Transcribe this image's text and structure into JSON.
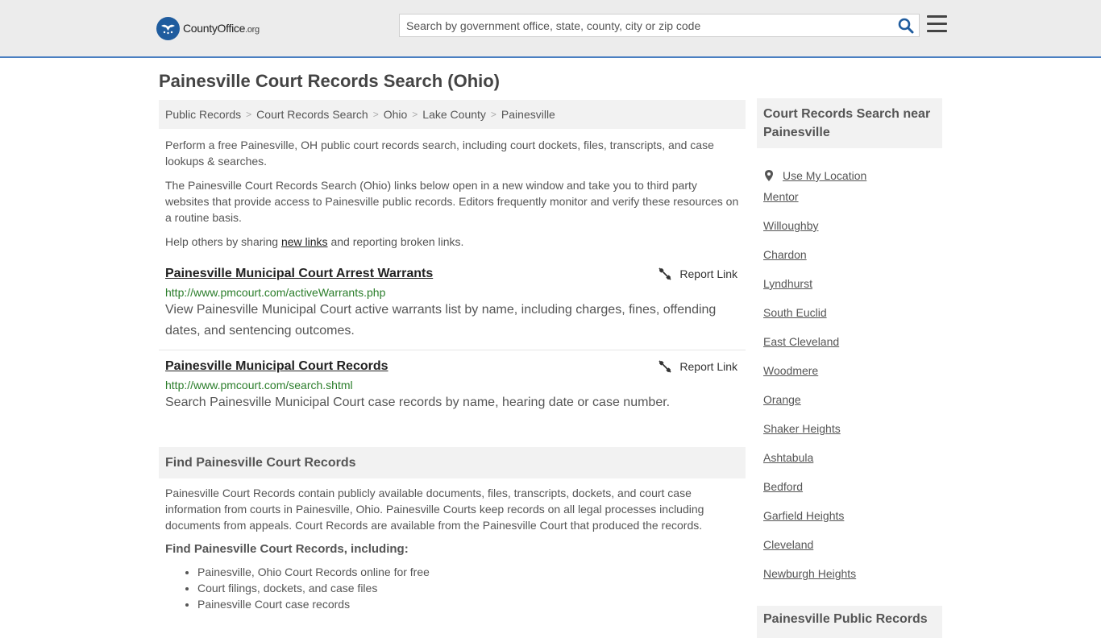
{
  "header": {
    "logo_name": "CountyOffice",
    "logo_suffix": ".org",
    "search_placeholder": "Search by government office, state, county, city or zip code",
    "accent_color": "#4a7fc1"
  },
  "page_title": "Painesville Court Records Search (Ohio)",
  "breadcrumb": [
    "Public Records",
    "Court Records Search",
    "Ohio",
    "Lake County",
    "Painesville"
  ],
  "intro": {
    "p1": "Perform a free Painesville, OH public court records search, including court dockets, files, transcripts, and case lookups & searches.",
    "p2": "The Painesville Court Records Search (Ohio) links below open in a new window and take you to third party websites that provide access to Painesville public records. Editors frequently monitor and verify these resources on a routine basis.",
    "p3_before": "Help others by sharing ",
    "p3_link": "new links",
    "p3_after": " and reporting broken links."
  },
  "records": [
    {
      "title": "Painesville Municipal Court Arrest Warrants",
      "url": "http://www.pmcourt.com/activeWarrants.php",
      "description": "View Painesville Municipal Court active warrants list by name, including charges, fines, offending dates, and sentencing outcomes.",
      "report_label": "Report Link"
    },
    {
      "title": "Painesville Municipal Court Records",
      "url": "http://www.pmcourt.com/search.shtml",
      "description": "Search Painesville Municipal Court case records by name, hearing date or case number.",
      "report_label": "Report Link"
    }
  ],
  "find": {
    "heading": "Find Painesville Court Records",
    "body": "Painesville Court Records contain publicly available documents, files, transcripts, dockets, and court case information from courts in Painesville, Ohio. Painesville Courts keep records on all legal processes including documents from appeals. Court Records are available from the Painesville Court that produced the records.",
    "subheading": "Find Painesville Court Records, including:",
    "items": [
      "Painesville, Ohio Court Records online for free",
      "Court filings, dockets, and case files",
      "Painesville Court case records"
    ]
  },
  "sidebar": {
    "heading": "Court Records Search near Painesville",
    "use_location": "Use My Location",
    "cities": [
      "Mentor",
      "Willoughby",
      "Chardon",
      "Lyndhurst",
      "South Euclid",
      "East Cleveland",
      "Woodmere",
      "Orange",
      "Shaker Heights",
      "Ashtabula",
      "Bedford",
      "Garfield Heights",
      "Cleveland",
      "Newburgh Heights"
    ],
    "heading2": "Painesville Public Records"
  }
}
